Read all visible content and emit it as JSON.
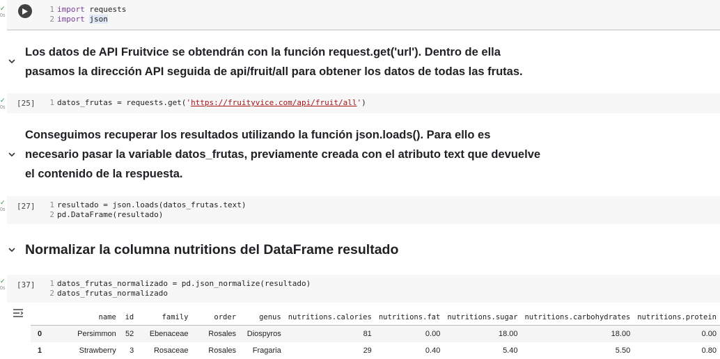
{
  "toolbar": {
    "icons": [
      "arrow-up-icon",
      "arrow-down-icon",
      "sparkle-icon",
      "link-icon",
      "comment-icon",
      "gear-icon",
      "copy-icon"
    ]
  },
  "cells": {
    "c1": {
      "status_time": "0s",
      "lines": [
        {
          "n": "1",
          "kw": "import",
          "rest": " requests"
        },
        {
          "n": "2",
          "kw": "import",
          "rest": "json"
        }
      ]
    },
    "md1": {
      "lines": [
        "Los datos de API Fruitvice se obtendrán con la función request.get('url'). Dentro de ella",
        "pasamos la dirección API seguida de api/fruit/all para obtener los datos de todas las frutas."
      ]
    },
    "c2": {
      "count": "[25]",
      "status_time": "0s",
      "line": {
        "n": "1",
        "pre": "datos_frutas = requests.get(",
        "q1": "'",
        "url": "https://fruityvice.com/api/fruit/all",
        "q2": "'",
        "post": ")"
      }
    },
    "md2": {
      "lines": [
        "Conseguimos recuperar los resultados utilizando la función json.loads(). Para ello es",
        "necesario pasar la variable datos_frutas, previamente creada con el atributo text que devuelve",
        "el contenido de la respuesta."
      ]
    },
    "c3": {
      "count": "[27]",
      "status_time": "0s",
      "lines": [
        {
          "n": "1",
          "text": "resultado = json.loads(datos_frutas.text)"
        },
        {
          "n": "2",
          "text": "pd.DataFrame(resultado)"
        }
      ]
    },
    "md3": {
      "heading": "Normalizar la columna nutritions del DataFrame resultado"
    },
    "c4": {
      "count": "[37]",
      "status_time": "0s",
      "lines": [
        {
          "n": "1",
          "text": "datos_frutas_normalizado = pd.json_normalize(resultado)"
        },
        {
          "n": "2",
          "text": "datos_frutas_normalizado"
        }
      ]
    }
  },
  "dataframe": {
    "columns": [
      "",
      "name",
      "id",
      "family",
      "order",
      "genus",
      "nutritions.calories",
      "nutritions.fat",
      "nutritions.sugar",
      "nutritions.carbohydrates",
      "nutritions.protein"
    ],
    "rows": [
      [
        "0",
        "Persimmon",
        "52",
        "Ebenaceae",
        "Rosales",
        "Diospyros",
        "81",
        "0.00",
        "18.00",
        "18.00",
        "0.00"
      ],
      [
        "1",
        "Strawberry",
        "3",
        "Rosaceae",
        "Rosales",
        "Fragaria",
        "29",
        "0.40",
        "5.40",
        "5.50",
        "0.80"
      ]
    ]
  },
  "colors": {
    "accent": "#1e8e3e",
    "cell_bg": "#f7f7f7"
  }
}
